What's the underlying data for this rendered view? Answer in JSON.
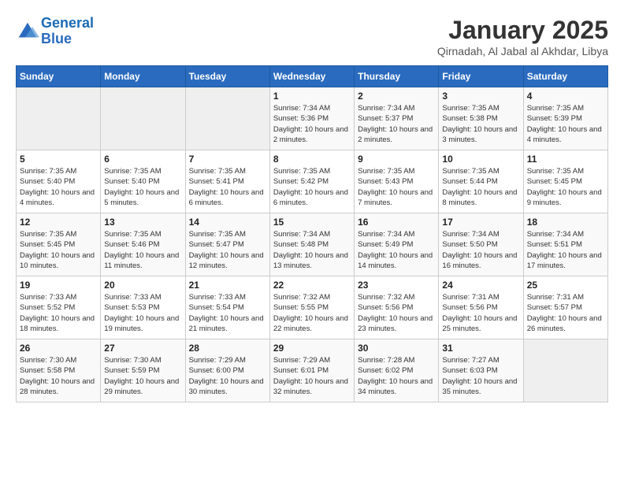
{
  "logo": {
    "line1": "General",
    "line2": "Blue"
  },
  "title": "January 2025",
  "subtitle": "Qirnadah, Al Jabal al Akhdar, Libya",
  "days_of_week": [
    "Sunday",
    "Monday",
    "Tuesday",
    "Wednesday",
    "Thursday",
    "Friday",
    "Saturday"
  ],
  "weeks": [
    [
      {
        "day": "",
        "sunrise": "",
        "sunset": "",
        "daylight": ""
      },
      {
        "day": "",
        "sunrise": "",
        "sunset": "",
        "daylight": ""
      },
      {
        "day": "",
        "sunrise": "",
        "sunset": "",
        "daylight": ""
      },
      {
        "day": "1",
        "sunrise": "Sunrise: 7:34 AM",
        "sunset": "Sunset: 5:36 PM",
        "daylight": "Daylight: 10 hours and 2 minutes."
      },
      {
        "day": "2",
        "sunrise": "Sunrise: 7:34 AM",
        "sunset": "Sunset: 5:37 PM",
        "daylight": "Daylight: 10 hours and 2 minutes."
      },
      {
        "day": "3",
        "sunrise": "Sunrise: 7:35 AM",
        "sunset": "Sunset: 5:38 PM",
        "daylight": "Daylight: 10 hours and 3 minutes."
      },
      {
        "day": "4",
        "sunrise": "Sunrise: 7:35 AM",
        "sunset": "Sunset: 5:39 PM",
        "daylight": "Daylight: 10 hours and 4 minutes."
      }
    ],
    [
      {
        "day": "5",
        "sunrise": "Sunrise: 7:35 AM",
        "sunset": "Sunset: 5:40 PM",
        "daylight": "Daylight: 10 hours and 4 minutes."
      },
      {
        "day": "6",
        "sunrise": "Sunrise: 7:35 AM",
        "sunset": "Sunset: 5:40 PM",
        "daylight": "Daylight: 10 hours and 5 minutes."
      },
      {
        "day": "7",
        "sunrise": "Sunrise: 7:35 AM",
        "sunset": "Sunset: 5:41 PM",
        "daylight": "Daylight: 10 hours and 6 minutes."
      },
      {
        "day": "8",
        "sunrise": "Sunrise: 7:35 AM",
        "sunset": "Sunset: 5:42 PM",
        "daylight": "Daylight: 10 hours and 6 minutes."
      },
      {
        "day": "9",
        "sunrise": "Sunrise: 7:35 AM",
        "sunset": "Sunset: 5:43 PM",
        "daylight": "Daylight: 10 hours and 7 minutes."
      },
      {
        "day": "10",
        "sunrise": "Sunrise: 7:35 AM",
        "sunset": "Sunset: 5:44 PM",
        "daylight": "Daylight: 10 hours and 8 minutes."
      },
      {
        "day": "11",
        "sunrise": "Sunrise: 7:35 AM",
        "sunset": "Sunset: 5:45 PM",
        "daylight": "Daylight: 10 hours and 9 minutes."
      }
    ],
    [
      {
        "day": "12",
        "sunrise": "Sunrise: 7:35 AM",
        "sunset": "Sunset: 5:45 PM",
        "daylight": "Daylight: 10 hours and 10 minutes."
      },
      {
        "day": "13",
        "sunrise": "Sunrise: 7:35 AM",
        "sunset": "Sunset: 5:46 PM",
        "daylight": "Daylight: 10 hours and 11 minutes."
      },
      {
        "day": "14",
        "sunrise": "Sunrise: 7:35 AM",
        "sunset": "Sunset: 5:47 PM",
        "daylight": "Daylight: 10 hours and 12 minutes."
      },
      {
        "day": "15",
        "sunrise": "Sunrise: 7:34 AM",
        "sunset": "Sunset: 5:48 PM",
        "daylight": "Daylight: 10 hours and 13 minutes."
      },
      {
        "day": "16",
        "sunrise": "Sunrise: 7:34 AM",
        "sunset": "Sunset: 5:49 PM",
        "daylight": "Daylight: 10 hours and 14 minutes."
      },
      {
        "day": "17",
        "sunrise": "Sunrise: 7:34 AM",
        "sunset": "Sunset: 5:50 PM",
        "daylight": "Daylight: 10 hours and 16 minutes."
      },
      {
        "day": "18",
        "sunrise": "Sunrise: 7:34 AM",
        "sunset": "Sunset: 5:51 PM",
        "daylight": "Daylight: 10 hours and 17 minutes."
      }
    ],
    [
      {
        "day": "19",
        "sunrise": "Sunrise: 7:33 AM",
        "sunset": "Sunset: 5:52 PM",
        "daylight": "Daylight: 10 hours and 18 minutes."
      },
      {
        "day": "20",
        "sunrise": "Sunrise: 7:33 AM",
        "sunset": "Sunset: 5:53 PM",
        "daylight": "Daylight: 10 hours and 19 minutes."
      },
      {
        "day": "21",
        "sunrise": "Sunrise: 7:33 AM",
        "sunset": "Sunset: 5:54 PM",
        "daylight": "Daylight: 10 hours and 21 minutes."
      },
      {
        "day": "22",
        "sunrise": "Sunrise: 7:32 AM",
        "sunset": "Sunset: 5:55 PM",
        "daylight": "Daylight: 10 hours and 22 minutes."
      },
      {
        "day": "23",
        "sunrise": "Sunrise: 7:32 AM",
        "sunset": "Sunset: 5:56 PM",
        "daylight": "Daylight: 10 hours and 23 minutes."
      },
      {
        "day": "24",
        "sunrise": "Sunrise: 7:31 AM",
        "sunset": "Sunset: 5:56 PM",
        "daylight": "Daylight: 10 hours and 25 minutes."
      },
      {
        "day": "25",
        "sunrise": "Sunrise: 7:31 AM",
        "sunset": "Sunset: 5:57 PM",
        "daylight": "Daylight: 10 hours and 26 minutes."
      }
    ],
    [
      {
        "day": "26",
        "sunrise": "Sunrise: 7:30 AM",
        "sunset": "Sunset: 5:58 PM",
        "daylight": "Daylight: 10 hours and 28 minutes."
      },
      {
        "day": "27",
        "sunrise": "Sunrise: 7:30 AM",
        "sunset": "Sunset: 5:59 PM",
        "daylight": "Daylight: 10 hours and 29 minutes."
      },
      {
        "day": "28",
        "sunrise": "Sunrise: 7:29 AM",
        "sunset": "Sunset: 6:00 PM",
        "daylight": "Daylight: 10 hours and 30 minutes."
      },
      {
        "day": "29",
        "sunrise": "Sunrise: 7:29 AM",
        "sunset": "Sunset: 6:01 PM",
        "daylight": "Daylight: 10 hours and 32 minutes."
      },
      {
        "day": "30",
        "sunrise": "Sunrise: 7:28 AM",
        "sunset": "Sunset: 6:02 PM",
        "daylight": "Daylight: 10 hours and 34 minutes."
      },
      {
        "day": "31",
        "sunrise": "Sunrise: 7:27 AM",
        "sunset": "Sunset: 6:03 PM",
        "daylight": "Daylight: 10 hours and 35 minutes."
      },
      {
        "day": "",
        "sunrise": "",
        "sunset": "",
        "daylight": ""
      }
    ]
  ]
}
